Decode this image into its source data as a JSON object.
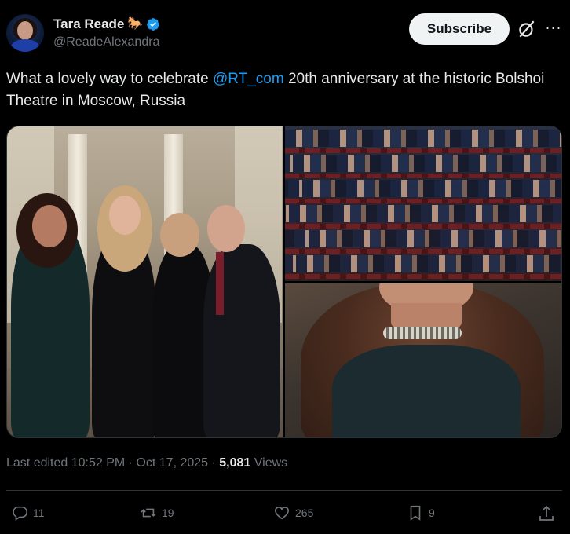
{
  "author": {
    "display_name": "Tara Reade",
    "emoji": "🐎",
    "handle": "@ReadeAlexandra",
    "verified_color": "#1d9bf0"
  },
  "header": {
    "subscribe_label": "Subscribe"
  },
  "post": {
    "text_before": "What a lovely way to celebrate ",
    "mention": "@RT_com",
    "text_after": " 20th anniversary at the historic Bolshoi Theatre in Moscow, Russia"
  },
  "meta": {
    "edited": "Last edited 10:52 PM · Oct 17, 2025 · ",
    "views_count": "5,081",
    "views_label": " Views"
  },
  "actions": {
    "replies": "11",
    "reposts": "19",
    "likes": "265",
    "bookmarks": "9"
  },
  "colors": {
    "background": "#000000",
    "accent": "#1d9bf0",
    "muted": "#71767b",
    "text": "#e7e9ea"
  },
  "icons": [
    "verified-icon",
    "grok-icon",
    "more-icon",
    "reply-icon",
    "repost-icon",
    "like-icon",
    "bookmark-icon",
    "share-icon"
  ]
}
